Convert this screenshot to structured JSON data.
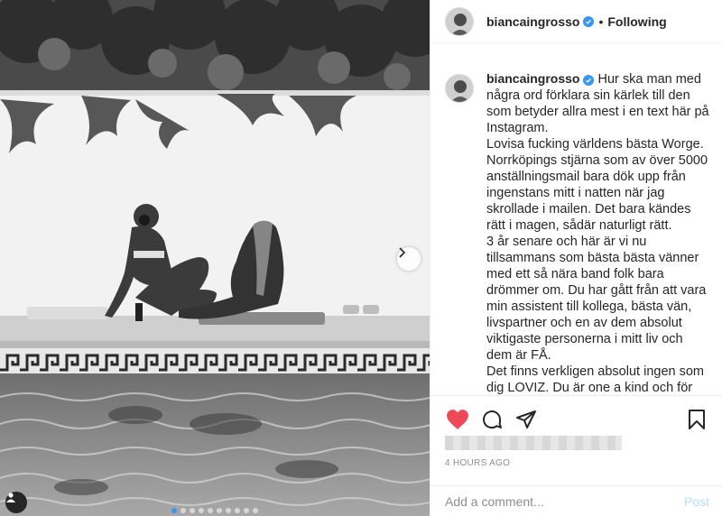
{
  "post": {
    "username": "biancaingrosso",
    "follow_status": "Following",
    "separator": "•",
    "caption": "Hur ska man med några ord förklara sin kärlek till den som betyder allra mest i en text här på Instagram.\nLovisa fucking världens bästa Worge. Norrköpings stjärna som av över 5000 anställningsmail bara dök upp från ingenstans mitt i natten när jag skrollade i mailen. Det bara kändes rätt i magen, sådär naturligt rätt.\n3 år senare och här är vi nu tillsammans som bästa bästa vänner med ett så nära band folk bara drömmer om. Du har gått från att vara min assistent till kollega, bästa vän, livspartner och en av dem absolut viktigaste personerna i mitt liv och dem är FÅ.\nDet finns verkligen absolut ingen som dig LOVIZ. Du är one a kind och för",
    "timestamp": "4 HOURS AGO",
    "comment_placeholder": "Add a comment...",
    "post_button": "Post",
    "carousel": {
      "total": 10,
      "active_index": 0
    }
  },
  "icons": {
    "like": "heart-icon",
    "comment": "comment-icon",
    "share": "paper-plane-icon",
    "save": "bookmark-icon",
    "next": "chevron-right-icon",
    "tag": "user-tag-icon",
    "verified": "verified-badge-icon"
  },
  "colors": {
    "like_active": "#ed4956",
    "verified": "#3897f0",
    "post_disabled": "#b2dffc",
    "muted_text": "#8e8e8e"
  }
}
